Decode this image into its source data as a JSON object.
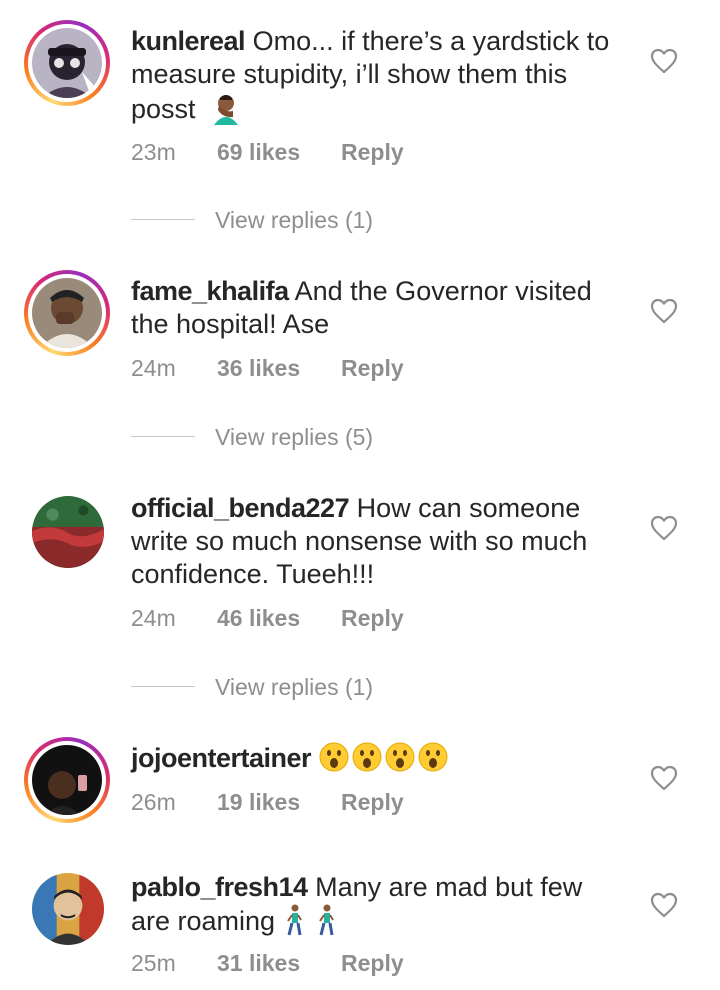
{
  "comments": [
    {
      "username": "kunlereal",
      "text": "Omo... if there’s a yardstick to measure stupidity, i’ll show them this posst",
      "emoji": "facepalm-emoji",
      "time": "23m",
      "likes": "69 likes",
      "reply": "Reply",
      "view_replies": "View replies (1)",
      "has_story_ring": true
    },
    {
      "username": "fame_khalifa",
      "text": "And the Governor visited the hospital! Ase",
      "time": "24m",
      "likes": "36 likes",
      "reply": "Reply",
      "view_replies": "View replies (5)",
      "has_story_ring": true
    },
    {
      "username": "official_benda227",
      "text": "How can someone write so much nonsense with so much confidence. Tueeh!!!",
      "time": "24m",
      "likes": "46 likes",
      "reply": "Reply",
      "view_replies": "View replies (1)",
      "has_story_ring": false
    },
    {
      "username": "jojoentertainer",
      "text": "",
      "emoji": "surprised-face-emoji x4",
      "time": "26m",
      "likes": "19 likes",
      "reply": "Reply",
      "has_story_ring": true
    },
    {
      "username": "pablo_fresh14",
      "text": "Many are mad but few are roaming",
      "emoji": "walking-man-emoji x2",
      "time": "25m",
      "likes": "31 likes",
      "reply": "Reply",
      "has_story_ring": false
    }
  ],
  "colors": {
    "text": "#262626",
    "meta": "#8e8e8e",
    "divider": "#c7c7c7",
    "ring_start": "#feda75",
    "ring_end": "#d62976"
  },
  "icons": {
    "like": "heart-outline-icon"
  }
}
